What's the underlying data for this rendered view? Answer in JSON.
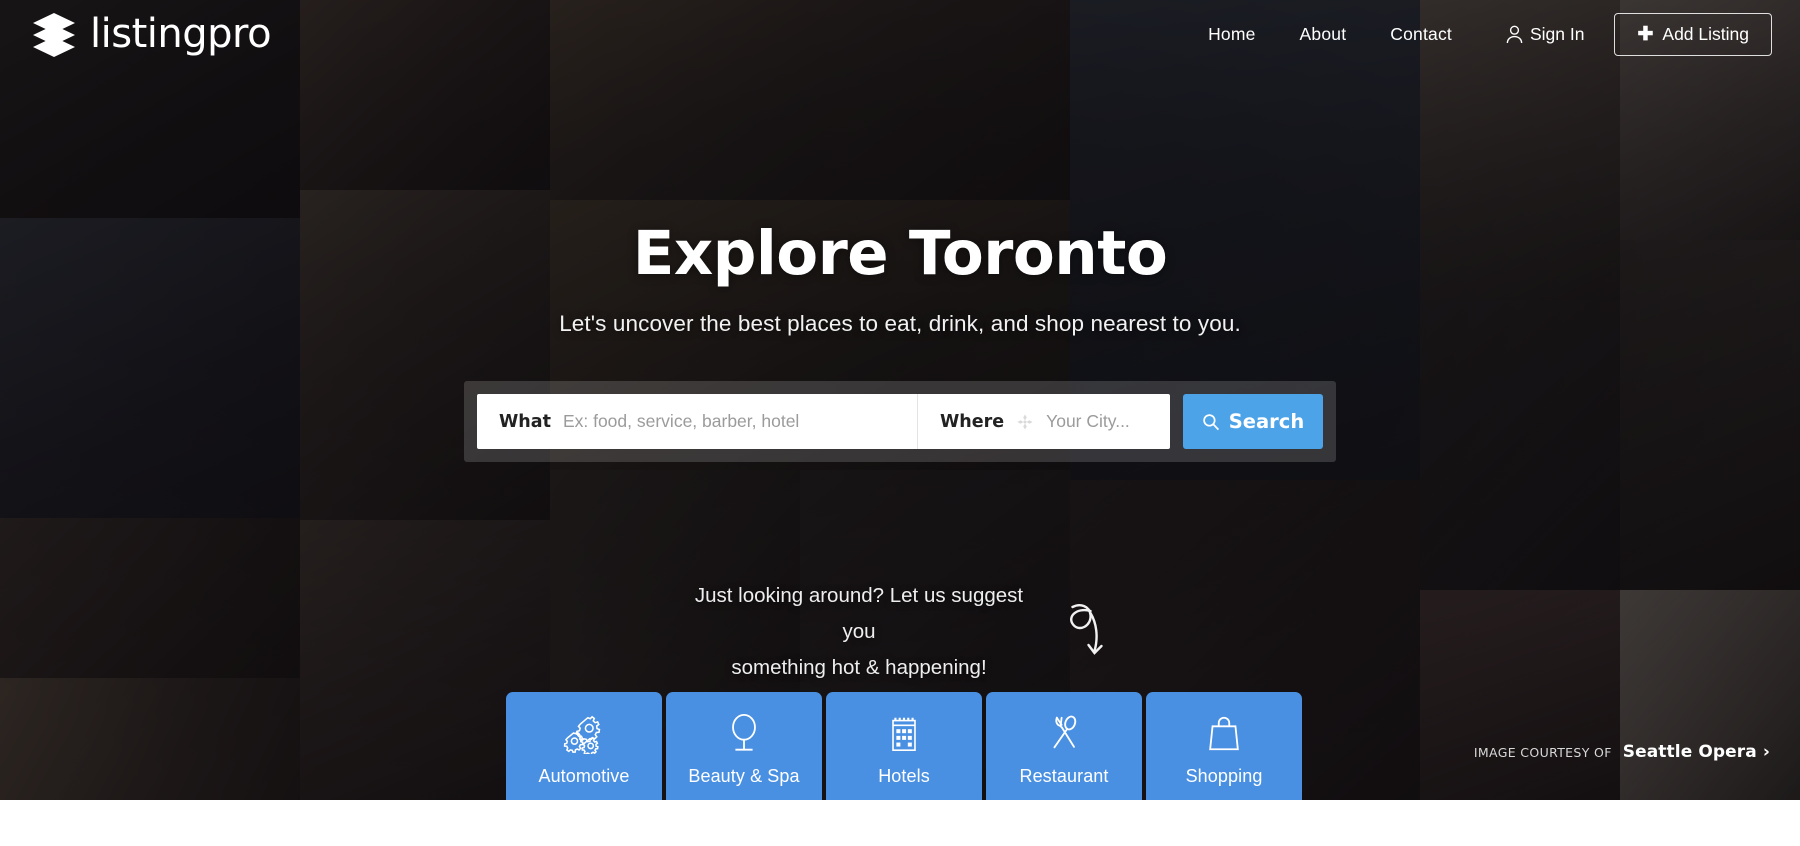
{
  "brand": {
    "name": "listingpro",
    "logo_icon": "stacked-layers-icon"
  },
  "header": {
    "nav": [
      {
        "label": "Home",
        "name": "nav-home"
      },
      {
        "label": "About",
        "name": "nav-about"
      },
      {
        "label": "Contact",
        "name": "nav-contact"
      }
    ],
    "sign_in": {
      "label": "Sign In",
      "icon": "user-icon"
    },
    "add_listing": {
      "label": "Add Listing",
      "icon": "plus-icon"
    }
  },
  "hero": {
    "title": "Explore Toronto",
    "subtitle": "Let's uncover the best places to eat, drink, and shop nearest to you."
  },
  "search": {
    "what_label": "What",
    "what_placeholder": "Ex: food, service, barber, hotel",
    "what_value": "",
    "where_label": "Where",
    "where_placeholder": "Your City...",
    "where_value": "",
    "where_icon": "geo-crosshair-icon",
    "button_label": "Search",
    "button_icon": "magnifier-icon",
    "button_color": "#4da3e8"
  },
  "suggest": {
    "line1": "Just looking around? Let us suggest you",
    "line2": "something hot & happening!",
    "icon": "curved-arrow-icon"
  },
  "credit": {
    "prefix": "IMAGE COURTESY OF",
    "name": "Seattle Opera",
    "chevron": "chevron-right-icon"
  },
  "categories": {
    "tile_color": "#4a90e2",
    "items": [
      {
        "label": "Automotive",
        "icon": "gears-icon"
      },
      {
        "label": "Beauty & Spa",
        "icon": "vanity-mirror-icon"
      },
      {
        "label": "Hotels",
        "icon": "building-icon"
      },
      {
        "label": "Restaurant",
        "icon": "fork-spoon-icon"
      },
      {
        "label": "Shopping",
        "icon": "shopping-bag-icon"
      }
    ]
  }
}
